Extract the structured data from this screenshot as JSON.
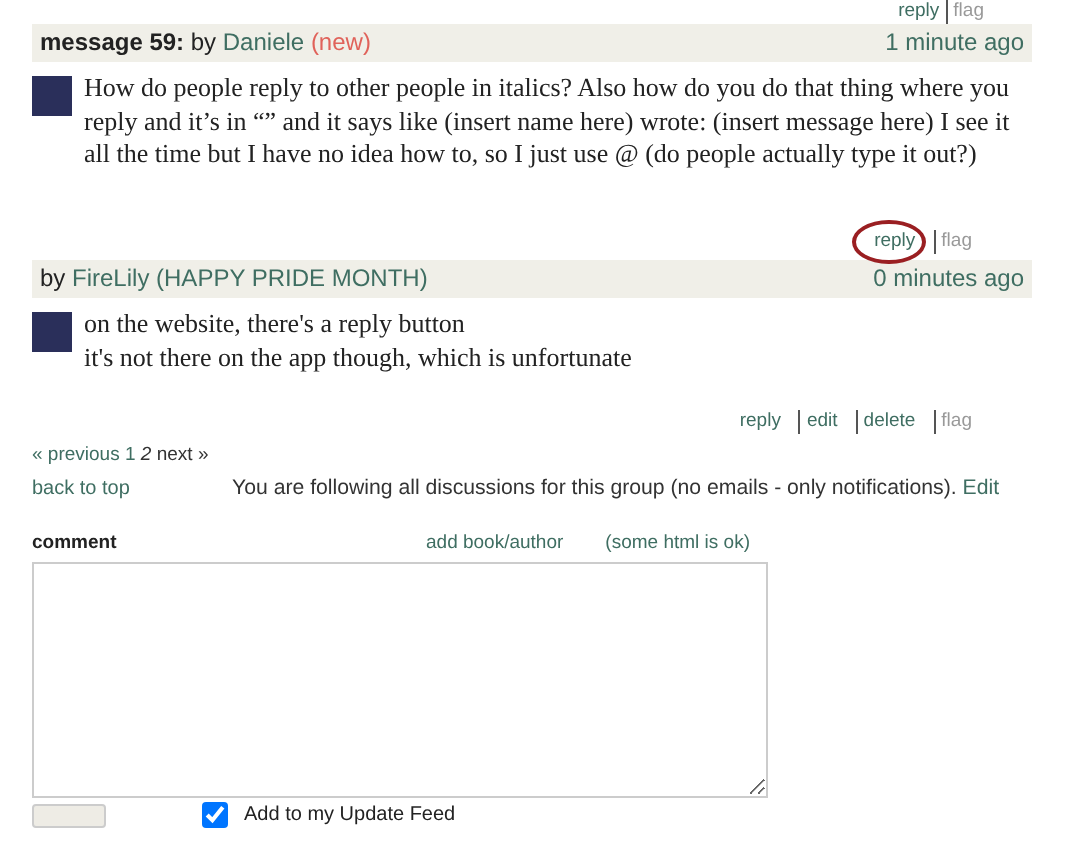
{
  "top_actions": [
    {
      "label": "reply",
      "kind": "link"
    },
    {
      "label": "flag",
      "kind": "muted"
    }
  ],
  "messages": [
    {
      "number": "message 59:",
      "by": "by",
      "author": "Daniele",
      "tag": "(new)",
      "time": "1 minute ago",
      "lines": [
        "How do people reply to other people in italics? Also how do you do that thing where you reply and it’s in “” and it says like (insert name here) wrote: (insert message here) I see it all the time but I have no idea how to, so I just use @ (do people actually type it out?)"
      ],
      "actions": [
        {
          "label": "reply",
          "kind": "link",
          "circled": true
        },
        {
          "label": "flag",
          "kind": "muted",
          "circled": false
        }
      ]
    },
    {
      "by": "by",
      "author": "FireLily (HAPPY PRIDE MONTH)",
      "time": "0 minutes ago",
      "lines": [
        "on the website, there's a reply button",
        "it's not there on the app though, which is unfortunate"
      ],
      "actions": [
        {
          "label": "reply",
          "kind": "link",
          "circled": false
        },
        {
          "label": "edit",
          "kind": "link",
          "circled": false
        },
        {
          "label": "delete",
          "kind": "link",
          "circled": false
        },
        {
          "label": "flag",
          "kind": "muted",
          "circled": false
        }
      ]
    }
  ],
  "pagination": {
    "previous": "« previous",
    "pages": [
      {
        "label": "1",
        "selected": false
      },
      {
        "label": "2",
        "selected": true
      }
    ],
    "next": "next »"
  },
  "back_to_top": "back to top",
  "following": {
    "text": "You are following all discussions for this group (no emails - only notifications).",
    "edit": "Edit"
  },
  "comment": {
    "label": "comment",
    "add_link": "add book/author",
    "hint": "(some html is ok)"
  },
  "update_feed": {
    "label": "Add to my Update Feed",
    "checked": true
  }
}
